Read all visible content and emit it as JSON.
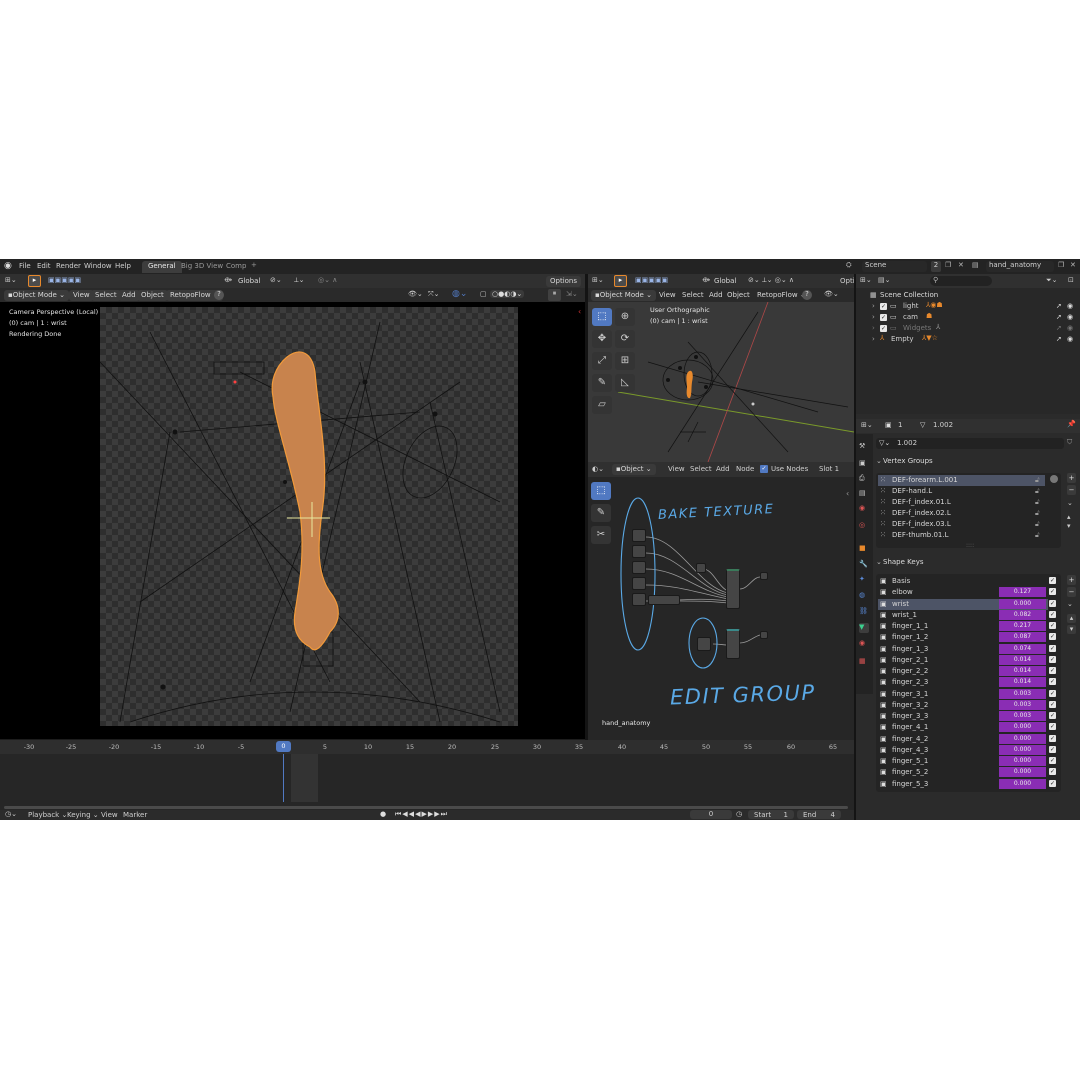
{
  "topbar": {
    "menus": [
      "File",
      "Edit",
      "Render",
      "Window",
      "Help"
    ],
    "tabs": [
      "General",
      "Big 3D View",
      "Comp"
    ],
    "active_tab": "General",
    "add_tab_glyph": "+",
    "scene_label": "Scene",
    "scene_count": "2",
    "view_layer": "hand_anatomy"
  },
  "viewport_left": {
    "orientation": "Global",
    "options_label": "Options",
    "mode": "Object Mode",
    "menus": [
      "View",
      "Select",
      "Add",
      "Object"
    ],
    "addon_menu": "RetopoFlow",
    "help_glyph": "?",
    "overlay_title": "Camera Perspective (Local)",
    "overlay_object": "(0) cam | 1 : wrist",
    "overlay_status": "Rendering Done"
  },
  "viewport_right": {
    "orientation": "Global",
    "options_label": "Opti",
    "mode": "Object Mode",
    "menus": [
      "View",
      "Select",
      "Add",
      "Object"
    ],
    "addon_menu": "RetopoFlow",
    "help_glyph": "?",
    "overlay_title": "User Orthographic",
    "overlay_object": "(0) cam | 1 : wrist"
  },
  "node_editor": {
    "type": "Object",
    "menus": [
      "View",
      "Select",
      "Add",
      "Node"
    ],
    "use_nodes_label": "Use Nodes",
    "slot_label": "Slot 1",
    "annotation_1": "BAKE TEXTURE",
    "annotation_2": "EDIT GROUP",
    "material_name": "hand_anatomy"
  },
  "timeline": {
    "ticks": [
      -30,
      -25,
      -20,
      -15,
      -10,
      -5,
      0,
      5,
      10,
      15,
      20,
      25,
      30,
      35,
      40,
      45,
      50,
      55,
      60,
      65
    ],
    "current_frame_label": "0",
    "menus": [
      "Playback",
      "Keying",
      "View",
      "Marker"
    ],
    "frame_field": "0",
    "start_label": "Start",
    "start_value": "1",
    "end_label": "End",
    "end_value": "4"
  },
  "outliner": {
    "root": "Scene Collection",
    "items": [
      {
        "name": "light",
        "dimmed": false
      },
      {
        "name": "cam",
        "dimmed": false
      },
      {
        "name": "Widgets",
        "dimmed": true
      },
      {
        "name": "Empty",
        "dimmed": false
      }
    ]
  },
  "properties": {
    "users_count": "1",
    "mesh_name": "1.002",
    "mesh_field": "1.002",
    "vertex_groups_title": "Vertex Groups",
    "vertex_groups": [
      "DEF-forearm.L.001",
      "DEF-hand.L",
      "DEF-f_index.01.L",
      "DEF-f_index.02.L",
      "DEF-f_index.03.L",
      "DEF-thumb.01.L"
    ],
    "active_vertex_group": "DEF-forearm.L.001",
    "shape_keys_title": "Shape Keys",
    "shape_keys": [
      {
        "name": "Basis",
        "value": null
      },
      {
        "name": "elbow",
        "value": "0.127"
      },
      {
        "name": "wrist",
        "value": "0.000"
      },
      {
        "name": "wrist_1",
        "value": "0.082"
      },
      {
        "name": "finger_1_1",
        "value": "0.217"
      },
      {
        "name": "finger_1_2",
        "value": "0.087"
      },
      {
        "name": "finger_1_3",
        "value": "0.074"
      },
      {
        "name": "finger_2_1",
        "value": "0.014"
      },
      {
        "name": "finger_2_2",
        "value": "0.014"
      },
      {
        "name": "finger_2_3",
        "value": "0.014"
      },
      {
        "name": "finger_3_1",
        "value": "0.003"
      },
      {
        "name": "finger_3_2",
        "value": "0.003"
      },
      {
        "name": "finger_3_3",
        "value": "0.003"
      },
      {
        "name": "finger_4_1",
        "value": "0.000"
      },
      {
        "name": "finger_4_2",
        "value": "0.000"
      },
      {
        "name": "finger_4_3",
        "value": "0.000"
      },
      {
        "name": "finger_5_1",
        "value": "0.000"
      },
      {
        "name": "finger_5_2",
        "value": "0.000"
      },
      {
        "name": "finger_5_3",
        "value": "0.000"
      }
    ],
    "active_shape_key": "wrist"
  },
  "colors": {
    "accent": "#5179c2",
    "shape_value": "#8a2db4",
    "object_orange": "#e8892c",
    "annotation_blue": "#5aa9e6"
  }
}
